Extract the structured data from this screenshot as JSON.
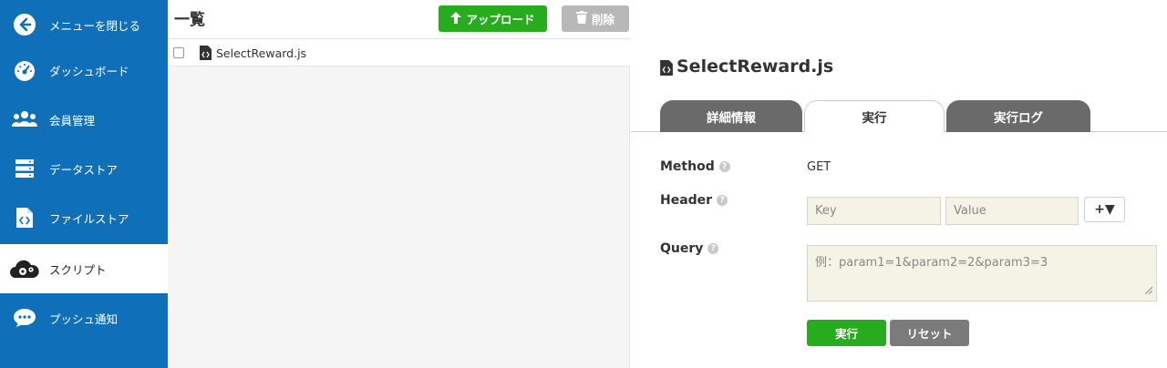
{
  "sidebar": {
    "items": [
      {
        "label": "メニューを閉じる",
        "icon": "arrow-left-circle-icon"
      },
      {
        "label": "ダッシュボード",
        "icon": "speedometer-icon"
      },
      {
        "label": "会員管理",
        "icon": "users-icon"
      },
      {
        "label": "データストア",
        "icon": "database-icon"
      },
      {
        "label": "ファイルストア",
        "icon": "file-code-icon"
      },
      {
        "label": "スクリプト",
        "icon": "cloud-gear-icon"
      },
      {
        "label": "プッシュ通知",
        "icon": "chat-bubble-icon"
      }
    ],
    "active_index": 5
  },
  "list": {
    "title": "一覧",
    "upload_label": "アップロード",
    "delete_label": "削除",
    "files": [
      {
        "name": "SelectReward.js",
        "checked": false
      }
    ]
  },
  "detail": {
    "title": "SelectReward.js",
    "tabs": [
      {
        "label": "詳細情報",
        "active": false
      },
      {
        "label": "実行",
        "active": true
      },
      {
        "label": "実行ログ",
        "active": false
      }
    ],
    "help_glyph": "?",
    "method": {
      "label": "Method",
      "value": "GET"
    },
    "header": {
      "label": "Header",
      "key_placeholder": "Key",
      "value_placeholder": "Value",
      "add_button_label": "+▼"
    },
    "query": {
      "label": "Query",
      "placeholder": "例：param1=1&param2=2&param3=3"
    },
    "run_label": "実行",
    "reset_label": "リセット"
  },
  "colors": {
    "sidebar_bg": "#0f6fb8",
    "primary_green": "#26ac1d",
    "tab_inactive": "#6a6a6a",
    "input_bg": "#f5f3e6"
  }
}
